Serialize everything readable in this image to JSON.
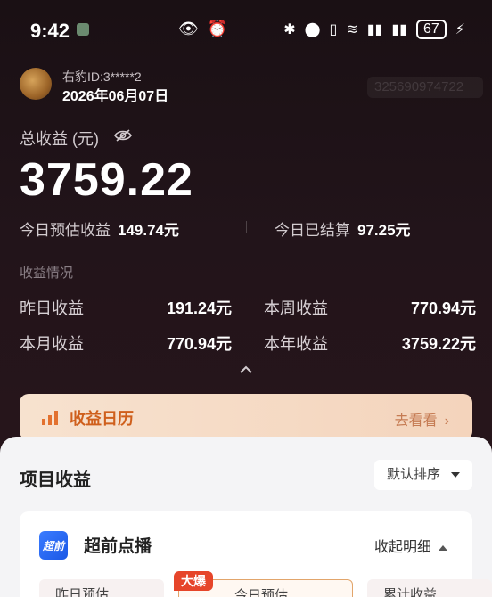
{
  "status": {
    "time": "9:42",
    "battery": "67"
  },
  "user": {
    "id_label": "右豹ID:3*****2",
    "date": "2026年06月07日",
    "blurred_number": "325690974722"
  },
  "earnings": {
    "total_label": "总收益 (元)",
    "total_value": "3759.22",
    "today_estimate_label": "今日预估收益",
    "today_estimate_value": "149.74元",
    "today_settled_label": "今日已结算",
    "today_settled_value": "97.25元"
  },
  "overview": {
    "section_label": "收益情况",
    "items": [
      {
        "label": "昨日收益",
        "value": "191.24元"
      },
      {
        "label": "本周收益",
        "value": "770.94元"
      },
      {
        "label": "本月收益",
        "value": "770.94元"
      },
      {
        "label": "本年收益",
        "value": "3759.22元"
      }
    ]
  },
  "calendar": {
    "title": "收益日历",
    "link": "去看看",
    "arrow": "›"
  },
  "projects": {
    "title": "项目收益",
    "sort_label": "默认排序",
    "card": {
      "icon_text": "超前",
      "title": "超前点播",
      "collapse_label": "收起明细",
      "tabs": [
        {
          "label": "昨日预估"
        },
        {
          "label": "今日预估",
          "badge": "大爆"
        },
        {
          "label": "累计收益"
        }
      ]
    }
  },
  "colors": {
    "accent_orange": "#cf5f1c",
    "card_blue": "#1a58e6",
    "badge_red": "#e6452a"
  }
}
